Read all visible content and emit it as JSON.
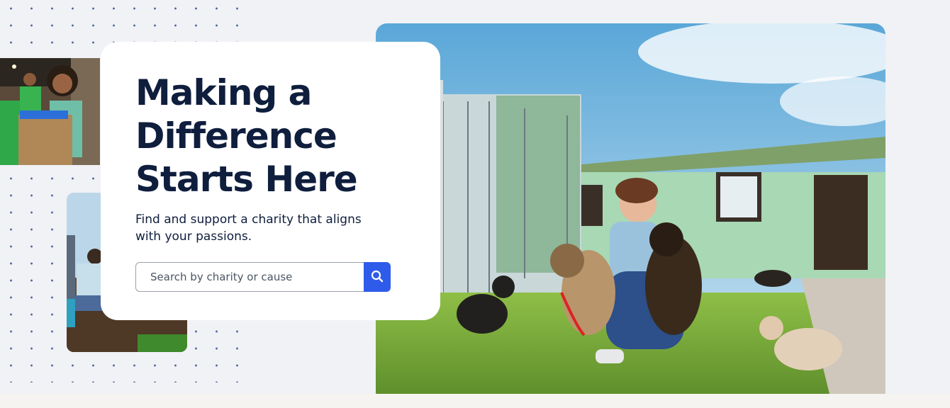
{
  "hero": {
    "headline_lines": [
      "Making a",
      "Difference",
      "Starts Here"
    ],
    "subtext": "Find and support a charity that aligns with your passions."
  },
  "search": {
    "placeholder": "Search by charity or cause",
    "value": "",
    "button_icon": "search-icon"
  },
  "images": {
    "top_left": "girl-holding-donation-bag-photo",
    "bottom_left": "volunteers-planting-photo",
    "main": "woman-with-shelter-dogs-photo"
  },
  "colors": {
    "headline": "#0f1e3d",
    "accent": "#2f5bea",
    "background": "#f1f2f5",
    "card": "#ffffff"
  }
}
